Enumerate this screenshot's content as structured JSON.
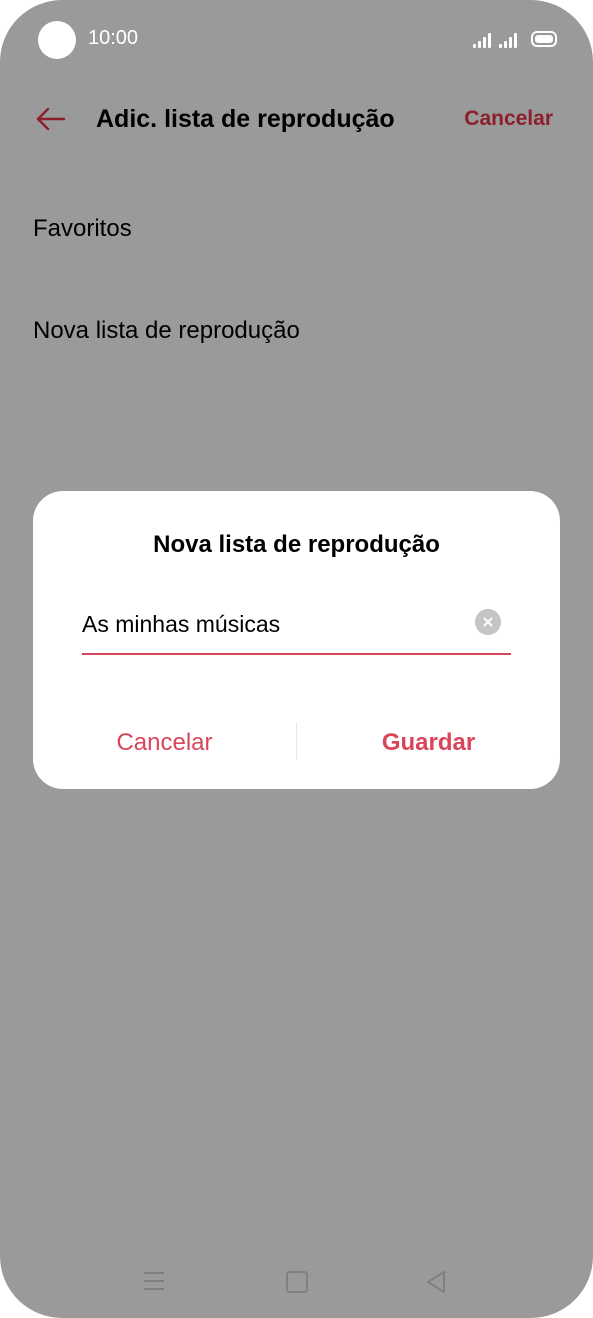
{
  "status_bar": {
    "time": "10:00"
  },
  "app_bar": {
    "title": "Adic. lista de reprodução",
    "cancel_label": "Cancelar",
    "back_icon": "arrow-left-icon"
  },
  "list": {
    "items": [
      {
        "label": "Favoritos"
      },
      {
        "label": "Nova lista de reprodução"
      }
    ]
  },
  "dialog": {
    "title": "Nova lista de reprodução",
    "input_value": "As minhas músicas",
    "cancel_label": "Cancelar",
    "save_label": "Guardar"
  },
  "colors": {
    "accent": "#d9455a",
    "accent_dark": "#8c1f2c",
    "scrim": "#9a9a9a"
  }
}
